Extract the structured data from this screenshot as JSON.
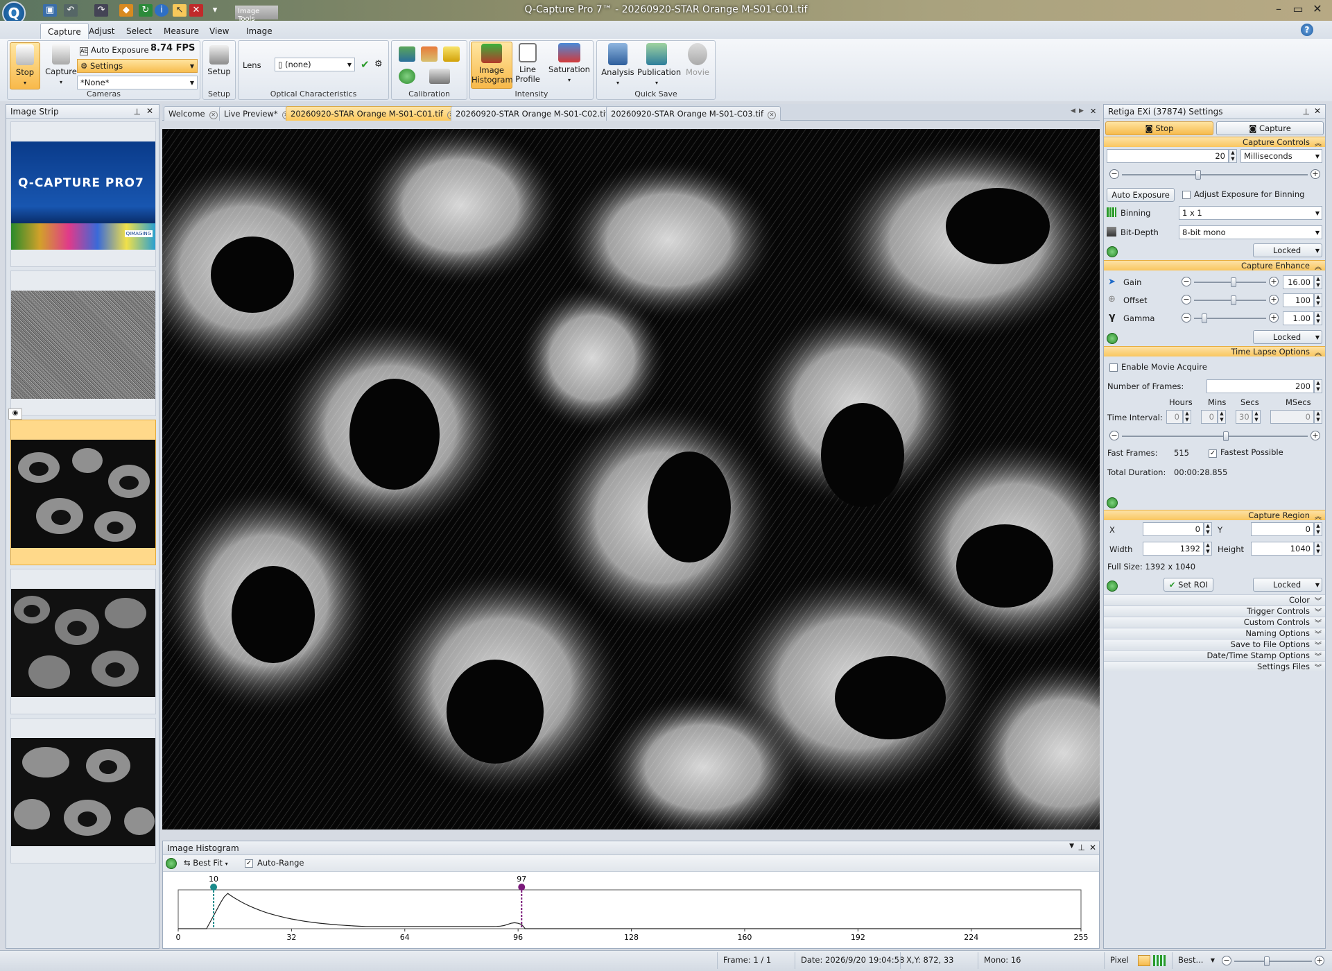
{
  "window": {
    "title": "Q-Capture Pro 7™ - 20260920-STAR Orange M-S01-C01.tif",
    "tool_tab": "Image Tools",
    "logo": "Q"
  },
  "ribbon_tabs": [
    "Capture",
    "Adjust",
    "Select",
    "Measure",
    "View",
    "Image"
  ],
  "active_ribbon_tab": "Capture",
  "ribbon": {
    "cameras": {
      "label": "Cameras",
      "stop": "Stop",
      "capture": "Capture",
      "auto_exposure": "Auto Exposure",
      "fps": "8.74 FPS",
      "settings": "Settings",
      "preset": "*None*"
    },
    "setup": {
      "label": "Setup",
      "button": "Setup"
    },
    "optical": {
      "label": "Optical Characteristics",
      "lens_label": "Lens",
      "lens_value": "(none)"
    },
    "calibration": {
      "label": "Calibration"
    },
    "intensity": {
      "label": "Intensity",
      "image_histogram": "Image Histogram",
      "line_profile": "Line Profile",
      "saturation": "Saturation"
    },
    "quick_save": {
      "label": "Quick Save",
      "analysis": "Analysis",
      "publication": "Publication",
      "movie": "Movie"
    }
  },
  "image_strip": {
    "title": "Image Strip",
    "splash_brand": "Q-CAPTURE PRO7",
    "splash_badge": "QIMAGING"
  },
  "doc_tabs": [
    "Welcome",
    "Live Preview*",
    "20260920-STAR Orange M-S01-C01.tif",
    "20260920-STAR Orange M-S01-C02.tif",
    "20260920-STAR Orange M-S01-C03.tif"
  ],
  "active_doc_tab": 2,
  "histogram": {
    "title": "Image Histogram",
    "fit_mode": "Best Fit",
    "auto_range_label": "Auto-Range",
    "auto_range_checked": true,
    "low_marker": 10,
    "high_marker": 97,
    "low_color": "#1a8a8a",
    "high_color": "#7a1a7a",
    "x_ticks": [
      "0",
      "32",
      "64",
      "96",
      "128",
      "160",
      "192",
      "224",
      "255"
    ]
  },
  "settings": {
    "title": "Retiga EXi (37874) Settings",
    "stop_tab": "Stop",
    "capture_tab": "Capture",
    "capture_controls": {
      "header": "Capture Controls",
      "exposure_value": "20",
      "exposure_unit": "Milliseconds",
      "auto_exposure_btn": "Auto Exposure",
      "adjust_binning_label": "Adjust Exposure for Binning",
      "binning_label": "Binning",
      "binning_value": "1 x 1",
      "bitdepth_label": "Bit-Depth",
      "bitdepth_value": "8-bit mono",
      "locked": "Locked"
    },
    "capture_enhance": {
      "header": "Capture Enhance",
      "gain_label": "Gain",
      "gain_value": "16.00",
      "offset_label": "Offset",
      "offset_value": "100",
      "gamma_label": "Gamma",
      "gamma_value": "1.00",
      "locked": "Locked"
    },
    "time_lapse": {
      "header": "Time Lapse Options",
      "enable_movie": "Enable Movie Acquire",
      "frames_label": "Number of Frames:",
      "frames_value": "200",
      "col_hours": "Hours",
      "col_mins": "Mins",
      "col_secs": "Secs",
      "col_msecs": "MSecs",
      "interval_label": "Time Interval:",
      "hours": "0",
      "mins": "0",
      "secs": "30",
      "msecs": "0",
      "fast_frames_label": "Fast Frames:",
      "fast_frames_value": "515",
      "fastest_label": "Fastest Possible",
      "duration_label": "Total Duration:",
      "duration_value": "00:00:28.855"
    },
    "capture_region": {
      "header": "Capture Region",
      "x_label": "X",
      "x_value": "0",
      "y_label": "Y",
      "y_value": "0",
      "width_label": "Width",
      "width_value": "1392",
      "height_label": "Height",
      "height_value": "1040",
      "full_size": "Full Size: 1392 x 1040",
      "set_roi": "Set ROI",
      "locked": "Locked"
    },
    "collapsed_sections": [
      "Color",
      "Trigger Controls",
      "Custom Controls",
      "Naming Options",
      "Save to File Options",
      "Date/Time Stamp Options",
      "Settings Files"
    ]
  },
  "status": {
    "frame": "Frame: 1 / 1",
    "date": "Date: 2026/9/20 19:04:58",
    "xy": "X,Y:  872,   33",
    "mono": "Mono:   16",
    "pixel": "Pixel",
    "zoom": "Best..."
  }
}
